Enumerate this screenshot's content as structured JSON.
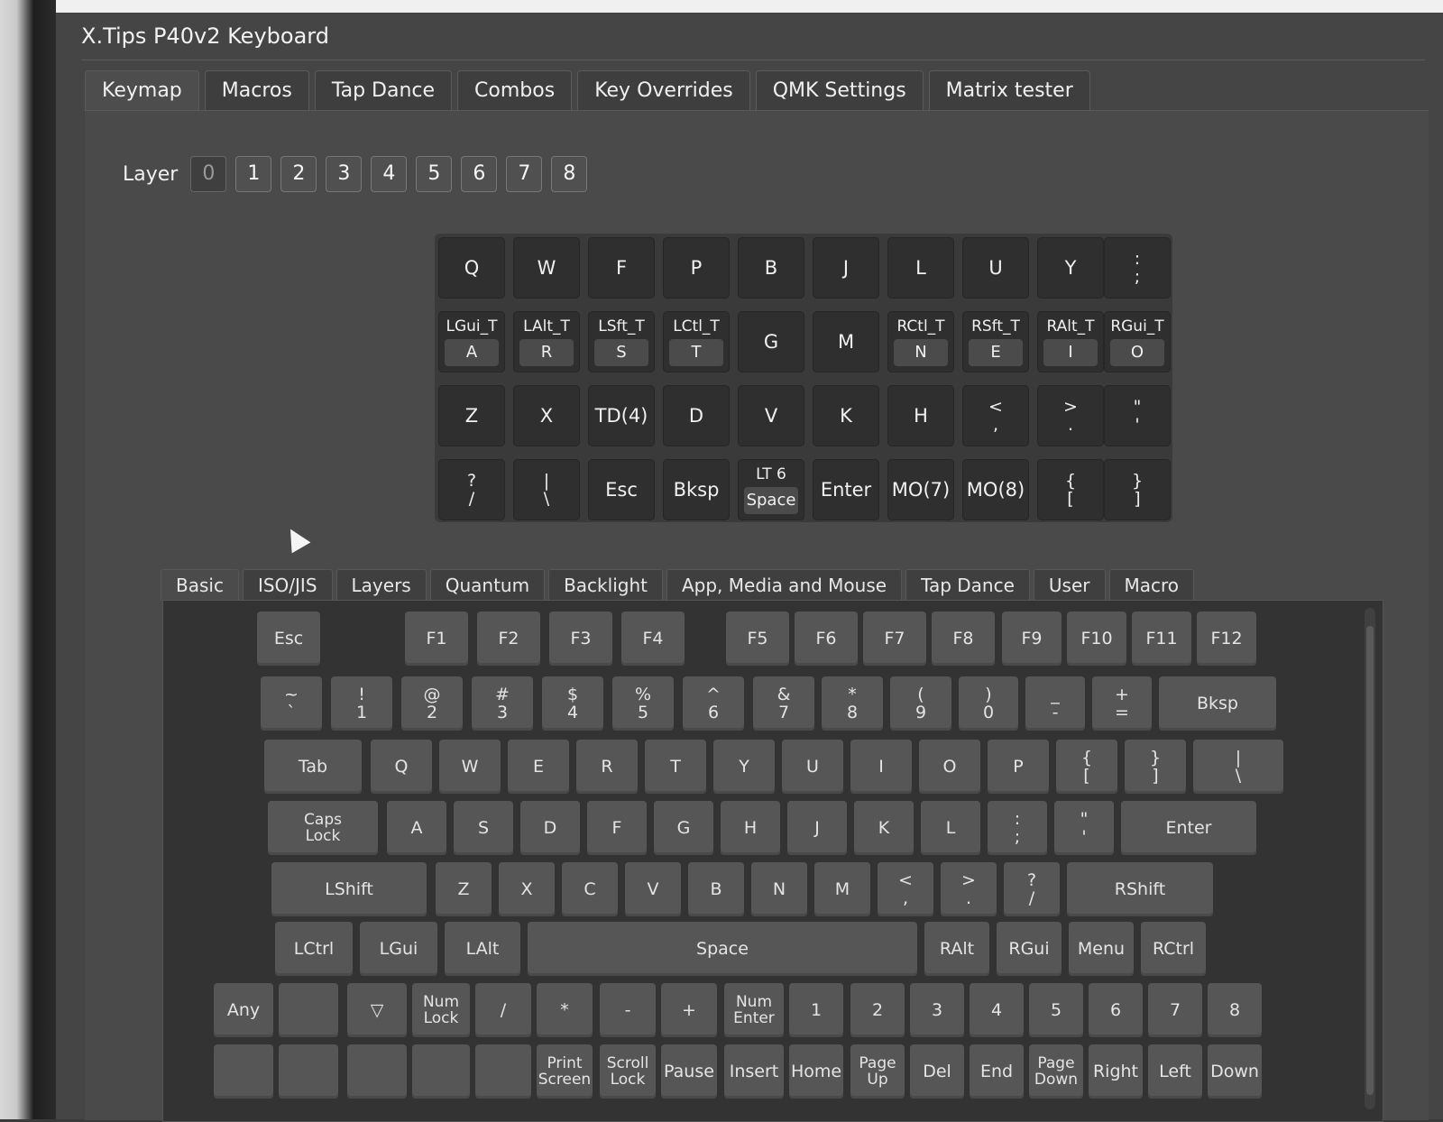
{
  "window": {
    "title": "X.Tips P40v2 Keyboard"
  },
  "tabs": [
    "Keymap",
    "Macros",
    "Tap Dance",
    "Combos",
    "Key Overrides",
    "QMK Settings",
    "Matrix tester"
  ],
  "layer": {
    "label": "Layer",
    "buttons": [
      "0",
      "1",
      "2",
      "3",
      "4",
      "5",
      "6",
      "7",
      "8"
    ],
    "selected": "0"
  },
  "keymap": {
    "rows": [
      [
        {
          "main": "Q"
        },
        {
          "main": "W"
        },
        {
          "main": "F"
        },
        {
          "main": "P"
        },
        {
          "main": "B"
        },
        {
          "main": "J"
        },
        {
          "main": "L"
        },
        {
          "main": "U"
        },
        {
          "main": "Y"
        },
        {
          "main": ":\n;"
        }
      ],
      [
        {
          "top": "LGui_T",
          "inner": "A"
        },
        {
          "top": "LAlt_T",
          "inner": "R"
        },
        {
          "top": "LSft_T",
          "inner": "S"
        },
        {
          "top": "LCtl_T",
          "inner": "T"
        },
        {
          "main": "G"
        },
        {
          "main": "M"
        },
        {
          "top": "RCtl_T",
          "inner": "N"
        },
        {
          "top": "RSft_T",
          "inner": "E"
        },
        {
          "top": "RAlt_T",
          "inner": "I"
        },
        {
          "top": "RGui_T",
          "inner": "O"
        }
      ],
      [
        {
          "main": "Z"
        },
        {
          "main": "X"
        },
        {
          "main": "TD(4)"
        },
        {
          "main": "D"
        },
        {
          "main": "V"
        },
        {
          "main": "K"
        },
        {
          "main": "H"
        },
        {
          "main": "<\n,"
        },
        {
          "main": ">\n."
        },
        {
          "main": "\"\n'"
        }
      ],
      [
        {
          "main": "?\n/"
        },
        {
          "main": "|\n\\"
        },
        {
          "main": "Esc"
        },
        {
          "main": "Bksp"
        },
        {
          "top": "LT 6",
          "inner": "Space"
        },
        {
          "main": "Enter"
        },
        {
          "main": "MO(7)"
        },
        {
          "main": "MO(8)"
        },
        {
          "main": "{\n["
        },
        {
          "main": "}\n]"
        }
      ]
    ]
  },
  "key_tabs": [
    "Basic",
    "ISO/JIS",
    "Layers",
    "Quantum",
    "Backlight",
    "App, Media and Mouse",
    "Tap Dance",
    "User",
    "Macro"
  ],
  "palette": {
    "row0": [
      "Esc",
      "F1",
      "F2",
      "F3",
      "F4",
      "F5",
      "F6",
      "F7",
      "F8",
      "F9",
      "F10",
      "F11",
      "F12"
    ],
    "row1": [
      "~\n`",
      "!\n1",
      "@\n2",
      "#\n3",
      "$\n4",
      "%\n5",
      "^\n6",
      "&\n7",
      "*\n8",
      "(\n9",
      ")\n0",
      "_\n-",
      "+\n=",
      "Bksp"
    ],
    "row2": [
      "Tab",
      "Q",
      "W",
      "E",
      "R",
      "T",
      "Y",
      "U",
      "I",
      "O",
      "P",
      "{\n[",
      "}\n]",
      "|\n\\"
    ],
    "row3": [
      "Caps\nLock",
      "A",
      "S",
      "D",
      "F",
      "G",
      "H",
      "J",
      "K",
      "L",
      ":\n;",
      "\"\n'",
      "Enter"
    ],
    "row4": [
      "LShift",
      "Z",
      "X",
      "C",
      "V",
      "B",
      "N",
      "M",
      "<\n,",
      ">\n.",
      "?\n/",
      "RShift"
    ],
    "row5": [
      "LCtrl",
      "LGui",
      "LAlt",
      "Space",
      "RAlt",
      "RGui",
      "Menu",
      "RCtrl"
    ],
    "row6": [
      "Any",
      "",
      "▽",
      "Num\nLock",
      "/",
      "*",
      "-",
      "+",
      "Num\nEnter",
      "1",
      "2",
      "3",
      "4",
      "5",
      "6",
      "7",
      "8"
    ],
    "row7": [
      "",
      "",
      "",
      "",
      "",
      "Print\nScreen",
      "Scroll\nLock",
      "Pause",
      "Insert",
      "Home",
      "Page\nUp",
      "Del",
      "End",
      "Page\nDown",
      "Right",
      "Left",
      "Down"
    ]
  }
}
